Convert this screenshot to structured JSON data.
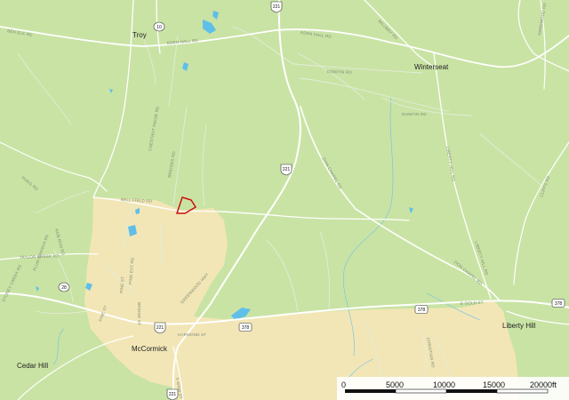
{
  "places": {
    "troy": "Troy",
    "winterseat": "Winterseat",
    "mccormick": "McCormick",
    "cedar_hill": "Cedar Hill",
    "liberty_hill": "Liberty Hill"
  },
  "roads": {
    "eden_hall_rd_1": "EDEN HALL RD",
    "eden_hall_rd_2": "EDEN HALL RD",
    "millway_rd": "MILLWAY RD",
    "dowtin_rd_1": "DOWTIN RD",
    "dowtin_rd_2": "DOWTIN RD",
    "zion_chapel_rd_1": "ZION CHAPEL RD",
    "zion_chapel_rd_2": "ZION CHAPEL RD",
    "liberty_hill_rd_1": "LIBERTY HILL RD",
    "liberty_hill_rd_2": "LIBERTY HILL RD",
    "greenwood_hwy": "GREENWOOD HWY",
    "e_gold_st": "E GOLD ST",
    "bell_field_rd": "BELL FIELD RD",
    "chestnut_ridge_rd": "CHESTNUT RIDGE RD",
    "bridges_rd": "BRIDGES RD",
    "taylor_creek_rd": "TAYLOR CREEK RD",
    "rob_run_rd": "ROB RUN RD",
    "harmond_st": "HARMOND ST",
    "pine_st": "PINE ST",
    "pine_st_2": "PINE ST",
    "pine_ext_rd": "PINE EXT RD",
    "bridge_st": "BRIDGE ST",
    "s_main_st": "S MAIN ST",
    "stoney_creek_rd": "STONEY CREEK RD",
    "plum_branch_rd": "PLUM BRANCH RD",
    "ben_elk_rd": "BEN ELK RD",
    "cliffs_rd": "CLIFFS RD",
    "hardwood_rd": "HARDWOOD RD",
    "hugg_rd": "HUGG RD",
    "christian_rd": "CHRISTIAN RD"
  },
  "shields": {
    "us221_top": "221",
    "us221_mid": "221",
    "us221_low": "221",
    "us221_bottom": "221",
    "sc10": "10",
    "sc28": "28",
    "us378_mid": "378",
    "us378_right": "378",
    "us378_edge": "378"
  },
  "scale": {
    "labels": [
      "0",
      "5000",
      "10000",
      "15000",
      "20000ft"
    ]
  },
  "colors": {
    "land": "#c9e3a4",
    "urban": "#f2e6b6",
    "road": "#ffffff",
    "water": "#5fbfe8",
    "parcel": "#cc1111"
  }
}
